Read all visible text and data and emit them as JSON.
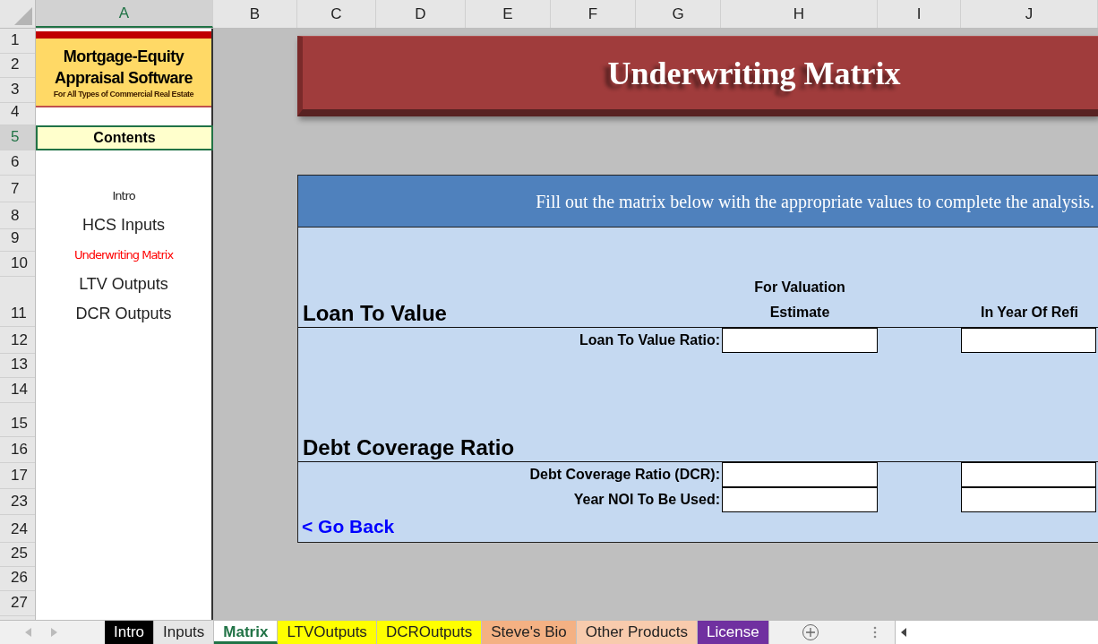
{
  "column_headers": [
    {
      "label": "A",
      "selected": true
    },
    {
      "label": "B",
      "selected": false
    },
    {
      "label": "C",
      "selected": false
    },
    {
      "label": "D",
      "selected": false
    },
    {
      "label": "E",
      "selected": false
    },
    {
      "label": "F",
      "selected": false
    },
    {
      "label": "G",
      "selected": false
    },
    {
      "label": "H",
      "selected": false
    },
    {
      "label": "I",
      "selected": false
    },
    {
      "label": "J",
      "selected": false
    }
  ],
  "row_headers": [
    {
      "label": "1",
      "selected": false
    },
    {
      "label": "2",
      "selected": false
    },
    {
      "label": "3",
      "selected": false
    },
    {
      "label": "4",
      "selected": false
    },
    {
      "label": "5",
      "selected": true
    },
    {
      "label": "6",
      "selected": false
    },
    {
      "label": "7",
      "selected": false
    },
    {
      "label": "8",
      "selected": false
    },
    {
      "label": "9",
      "selected": false
    },
    {
      "label": "10",
      "selected": false
    },
    {
      "label": "11",
      "selected": false
    },
    {
      "label": "12",
      "selected": false
    },
    {
      "label": "13",
      "selected": false
    },
    {
      "label": "14",
      "selected": false
    },
    {
      "label": "15",
      "selected": false
    },
    {
      "label": "16",
      "selected": false
    },
    {
      "label": "17",
      "selected": false
    },
    {
      "label": "23",
      "selected": false
    },
    {
      "label": "24",
      "selected": false
    },
    {
      "label": "25",
      "selected": false
    },
    {
      "label": "26",
      "selected": false
    },
    {
      "label": "27",
      "selected": false
    }
  ],
  "logo": {
    "title_line_1": "Mortgage-Equity",
    "title_line_2": "Appraisal Software",
    "tagline": "For All Types of Commercial Real Estate"
  },
  "contents": {
    "heading": "Contents",
    "items": [
      {
        "label": "Intro",
        "kind": "narrow",
        "selected": false
      },
      {
        "label": "HCS Inputs",
        "kind": "regular",
        "selected": false
      },
      {
        "label": "Underwriting Matrix",
        "kind": "narrow",
        "selected": true
      },
      {
        "label": "LTV Outputs",
        "kind": "regular",
        "selected": false
      },
      {
        "label": "DCR Outputs",
        "kind": "regular",
        "selected": false
      }
    ]
  },
  "banner": {
    "title": "Underwriting Matrix"
  },
  "matrix": {
    "instructions": "Fill out the matrix below with the appropriate values to complete the analysis.",
    "columns": [
      "For Valuation Estimate",
      "In Year Of Refi"
    ],
    "sections": [
      {
        "title": "Loan To Value",
        "rows": [
          {
            "label": "Loan To Value Ratio:"
          }
        ]
      },
      {
        "title": "Debt Coverage Ratio",
        "rows": [
          {
            "label": "Debt Coverage Ratio (DCR):"
          },
          {
            "label": "Year NOI To Be Used:"
          }
        ]
      }
    ],
    "back_link": "< Go Back"
  },
  "sheet_tabs": [
    {
      "label": "Intro",
      "selected": false,
      "color": "#000000"
    },
    {
      "label": "Inputs",
      "selected": false,
      "color": "#e6e6e6"
    },
    {
      "label": "Matrix",
      "selected": true,
      "color": "#ffffff"
    },
    {
      "label": "LTVOutputs",
      "selected": false,
      "color": "#ffff00"
    },
    {
      "label": "DCROutputs",
      "selected": false,
      "color": "#ffff00"
    },
    {
      "label": "Steve's Bio",
      "selected": false,
      "color": "#f4b183"
    },
    {
      "label": "Other Products",
      "selected": false,
      "color": "#f8cbad"
    },
    {
      "label": "License",
      "selected": false,
      "color": "#7030a0"
    }
  ]
}
